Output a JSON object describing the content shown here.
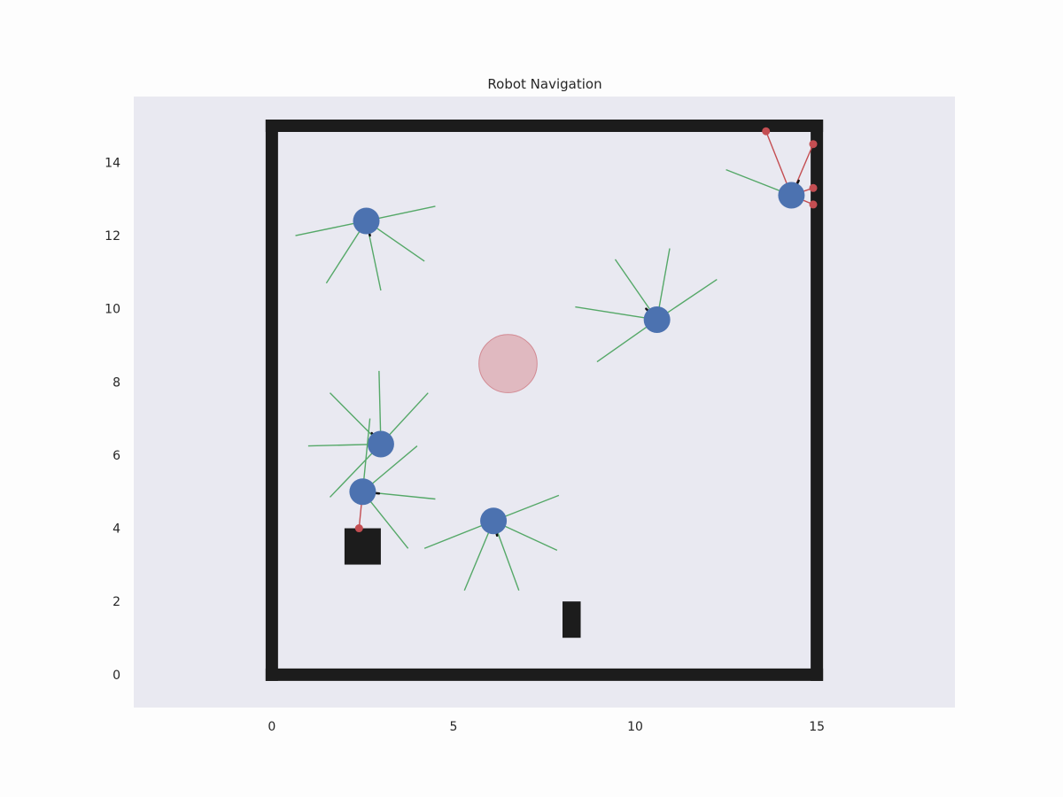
{
  "chart_data": {
    "type": "scatter",
    "title": "Robot Navigation",
    "xlabel": "",
    "ylabel": "",
    "xlim": [
      -3.8,
      18.8
    ],
    "ylim": [
      -0.9,
      15.8
    ],
    "grid": false,
    "x_ticks": [
      0,
      5,
      10,
      15
    ],
    "y_ticks": [
      0,
      2,
      4,
      6,
      8,
      10,
      12,
      14
    ],
    "colors": {
      "axes_bg": "#e9e9f1",
      "wall": "#1c1c1c",
      "robot": "#4c72b0",
      "sensor_clear": "#55a868",
      "sensor_hit": "#c44e52",
      "goal": "#dba4ab",
      "heading": "#111111"
    },
    "walls": [
      {
        "x0": 0,
        "y0": 0,
        "x1": 15,
        "y1": 0
      },
      {
        "x0": 15,
        "y0": 0,
        "x1": 15,
        "y1": 15
      },
      {
        "x0": 15,
        "y0": 15,
        "x1": 0,
        "y1": 15
      },
      {
        "x0": 0,
        "y0": 15,
        "x1": 0,
        "y1": 0
      }
    ],
    "obstacles": [
      {
        "x": 2.0,
        "y": 3.0,
        "w": 1.0,
        "h": 1.0
      },
      {
        "x": 8.0,
        "y": 1.0,
        "w": 0.5,
        "h": 1.0
      }
    ],
    "goal": {
      "x": 6.5,
      "y": 8.5,
      "r": 0.8
    },
    "robots": [
      {
        "x": 2.6,
        "y": 12.4,
        "heading": [
          2.7,
          12.0
        ],
        "sensors": [
          {
            "x": 4.5,
            "y": 12.8,
            "hit": false
          },
          {
            "x": 4.2,
            "y": 11.3,
            "hit": false
          },
          {
            "x": 3.0,
            "y": 10.5,
            "hit": false
          },
          {
            "x": 1.5,
            "y": 10.7,
            "hit": false
          },
          {
            "x": 0.65,
            "y": 12.0,
            "hit": false
          }
        ]
      },
      {
        "x": 10.6,
        "y": 9.7,
        "heading": [
          10.3,
          10.0
        ],
        "sensors": [
          {
            "x": 12.25,
            "y": 10.8,
            "hit": false
          },
          {
            "x": 10.95,
            "y": 11.65,
            "hit": false
          },
          {
            "x": 9.45,
            "y": 11.35,
            "hit": false
          },
          {
            "x": 8.35,
            "y": 10.05,
            "hit": false
          },
          {
            "x": 8.95,
            "y": 8.55,
            "hit": false
          }
        ]
      },
      {
        "x": 14.3,
        "y": 13.1,
        "heading": [
          14.5,
          13.5
        ],
        "sensors": [
          {
            "x": 14.9,
            "y": 14.5,
            "hit": true
          },
          {
            "x": 13.6,
            "y": 14.85,
            "hit": true
          },
          {
            "x": 14.9,
            "y": 13.3,
            "hit": true
          },
          {
            "x": 14.9,
            "y": 12.85,
            "hit": true
          },
          {
            "x": 12.5,
            "y": 13.8,
            "hit": false
          }
        ]
      },
      {
        "x": 3.0,
        "y": 6.3,
        "heading": [
          2.75,
          6.6
        ],
        "sensors": [
          {
            "x": 4.3,
            "y": 7.7,
            "hit": false
          },
          {
            "x": 2.95,
            "y": 8.3,
            "hit": false
          },
          {
            "x": 1.6,
            "y": 7.7,
            "hit": false
          },
          {
            "x": 1.0,
            "y": 6.25,
            "hit": false
          },
          {
            "x": 1.6,
            "y": 4.85,
            "hit": false
          }
        ]
      },
      {
        "x": 2.5,
        "y": 5.0,
        "heading": [
          2.95,
          4.95
        ],
        "sensors": [
          {
            "x": 4.5,
            "y": 4.8,
            "hit": false
          },
          {
            "x": 3.75,
            "y": 3.45,
            "hit": true,
            "clear": true
          },
          {
            "x": 2.4,
            "y": 4.0,
            "hit": true
          },
          {
            "x": 2.7,
            "y": 7.0,
            "hit": false
          },
          {
            "x": 4.0,
            "y": 6.25,
            "hit": false
          }
        ]
      },
      {
        "x": 6.1,
        "y": 4.2,
        "heading": [
          6.2,
          3.8
        ],
        "sensors": [
          {
            "x": 7.9,
            "y": 4.9,
            "hit": false
          },
          {
            "x": 7.85,
            "y": 3.4,
            "hit": false
          },
          {
            "x": 6.8,
            "y": 2.3,
            "hit": false
          },
          {
            "x": 5.3,
            "y": 2.3,
            "hit": false
          },
          {
            "x": 4.2,
            "y": 3.45,
            "hit": false
          }
        ]
      }
    ]
  }
}
